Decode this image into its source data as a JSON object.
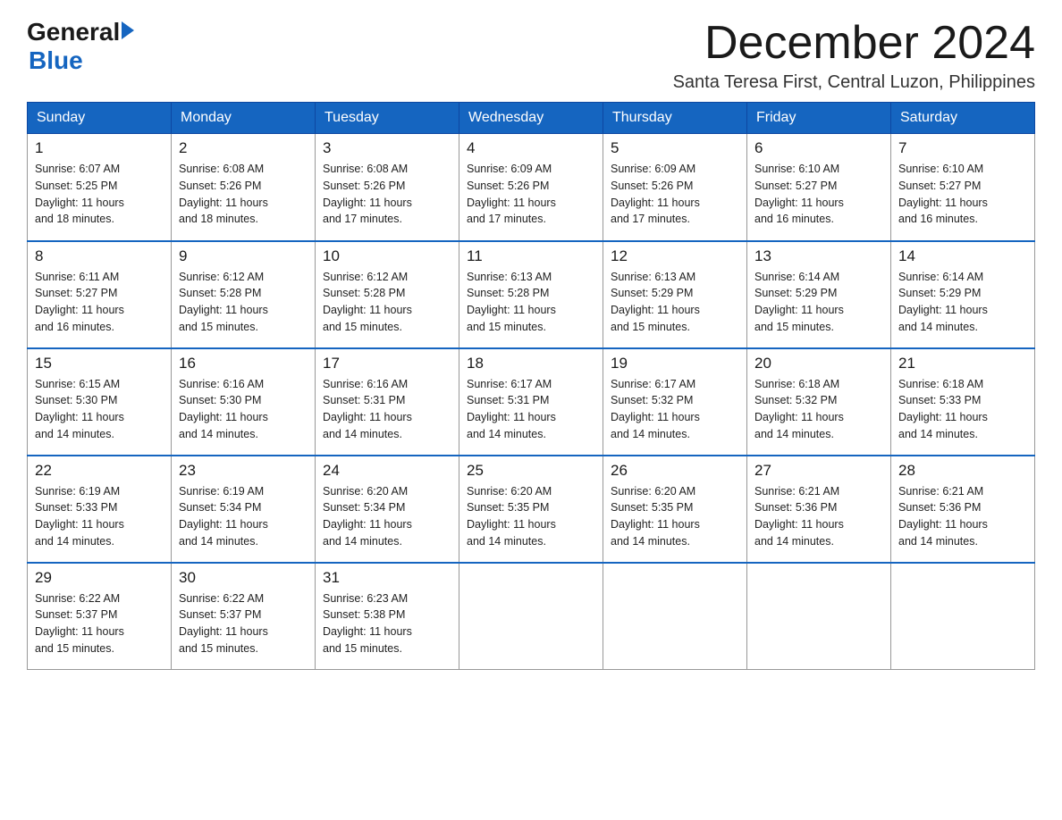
{
  "logo": {
    "line1": "General",
    "arrow": "▶",
    "line2": "Blue"
  },
  "title": {
    "month": "December 2024",
    "location": "Santa Teresa First, Central Luzon, Philippines"
  },
  "days_of_week": [
    "Sunday",
    "Monday",
    "Tuesday",
    "Wednesday",
    "Thursday",
    "Friday",
    "Saturday"
  ],
  "weeks": [
    [
      {
        "day": "1",
        "sunrise": "6:07 AM",
        "sunset": "5:25 PM",
        "daylight": "11 hours and 18 minutes."
      },
      {
        "day": "2",
        "sunrise": "6:08 AM",
        "sunset": "5:26 PM",
        "daylight": "11 hours and 18 minutes."
      },
      {
        "day": "3",
        "sunrise": "6:08 AM",
        "sunset": "5:26 PM",
        "daylight": "11 hours and 17 minutes."
      },
      {
        "day": "4",
        "sunrise": "6:09 AM",
        "sunset": "5:26 PM",
        "daylight": "11 hours and 17 minutes."
      },
      {
        "day": "5",
        "sunrise": "6:09 AM",
        "sunset": "5:26 PM",
        "daylight": "11 hours and 17 minutes."
      },
      {
        "day": "6",
        "sunrise": "6:10 AM",
        "sunset": "5:27 PM",
        "daylight": "11 hours and 16 minutes."
      },
      {
        "day": "7",
        "sunrise": "6:10 AM",
        "sunset": "5:27 PM",
        "daylight": "11 hours and 16 minutes."
      }
    ],
    [
      {
        "day": "8",
        "sunrise": "6:11 AM",
        "sunset": "5:27 PM",
        "daylight": "11 hours and 16 minutes."
      },
      {
        "day": "9",
        "sunrise": "6:12 AM",
        "sunset": "5:28 PM",
        "daylight": "11 hours and 15 minutes."
      },
      {
        "day": "10",
        "sunrise": "6:12 AM",
        "sunset": "5:28 PM",
        "daylight": "11 hours and 15 minutes."
      },
      {
        "day": "11",
        "sunrise": "6:13 AM",
        "sunset": "5:28 PM",
        "daylight": "11 hours and 15 minutes."
      },
      {
        "day": "12",
        "sunrise": "6:13 AM",
        "sunset": "5:29 PM",
        "daylight": "11 hours and 15 minutes."
      },
      {
        "day": "13",
        "sunrise": "6:14 AM",
        "sunset": "5:29 PM",
        "daylight": "11 hours and 15 minutes."
      },
      {
        "day": "14",
        "sunrise": "6:14 AM",
        "sunset": "5:29 PM",
        "daylight": "11 hours and 14 minutes."
      }
    ],
    [
      {
        "day": "15",
        "sunrise": "6:15 AM",
        "sunset": "5:30 PM",
        "daylight": "11 hours and 14 minutes."
      },
      {
        "day": "16",
        "sunrise": "6:16 AM",
        "sunset": "5:30 PM",
        "daylight": "11 hours and 14 minutes."
      },
      {
        "day": "17",
        "sunrise": "6:16 AM",
        "sunset": "5:31 PM",
        "daylight": "11 hours and 14 minutes."
      },
      {
        "day": "18",
        "sunrise": "6:17 AM",
        "sunset": "5:31 PM",
        "daylight": "11 hours and 14 minutes."
      },
      {
        "day": "19",
        "sunrise": "6:17 AM",
        "sunset": "5:32 PM",
        "daylight": "11 hours and 14 minutes."
      },
      {
        "day": "20",
        "sunrise": "6:18 AM",
        "sunset": "5:32 PM",
        "daylight": "11 hours and 14 minutes."
      },
      {
        "day": "21",
        "sunrise": "6:18 AM",
        "sunset": "5:33 PM",
        "daylight": "11 hours and 14 minutes."
      }
    ],
    [
      {
        "day": "22",
        "sunrise": "6:19 AM",
        "sunset": "5:33 PM",
        "daylight": "11 hours and 14 minutes."
      },
      {
        "day": "23",
        "sunrise": "6:19 AM",
        "sunset": "5:34 PM",
        "daylight": "11 hours and 14 minutes."
      },
      {
        "day": "24",
        "sunrise": "6:20 AM",
        "sunset": "5:34 PM",
        "daylight": "11 hours and 14 minutes."
      },
      {
        "day": "25",
        "sunrise": "6:20 AM",
        "sunset": "5:35 PM",
        "daylight": "11 hours and 14 minutes."
      },
      {
        "day": "26",
        "sunrise": "6:20 AM",
        "sunset": "5:35 PM",
        "daylight": "11 hours and 14 minutes."
      },
      {
        "day": "27",
        "sunrise": "6:21 AM",
        "sunset": "5:36 PM",
        "daylight": "11 hours and 14 minutes."
      },
      {
        "day": "28",
        "sunrise": "6:21 AM",
        "sunset": "5:36 PM",
        "daylight": "11 hours and 14 minutes."
      }
    ],
    [
      {
        "day": "29",
        "sunrise": "6:22 AM",
        "sunset": "5:37 PM",
        "daylight": "11 hours and 15 minutes."
      },
      {
        "day": "30",
        "sunrise": "6:22 AM",
        "sunset": "5:37 PM",
        "daylight": "11 hours and 15 minutes."
      },
      {
        "day": "31",
        "sunrise": "6:23 AM",
        "sunset": "5:38 PM",
        "daylight": "11 hours and 15 minutes."
      },
      null,
      null,
      null,
      null
    ]
  ],
  "labels": {
    "sunrise_prefix": "Sunrise: ",
    "sunset_prefix": "Sunset: ",
    "daylight_prefix": "Daylight: "
  }
}
